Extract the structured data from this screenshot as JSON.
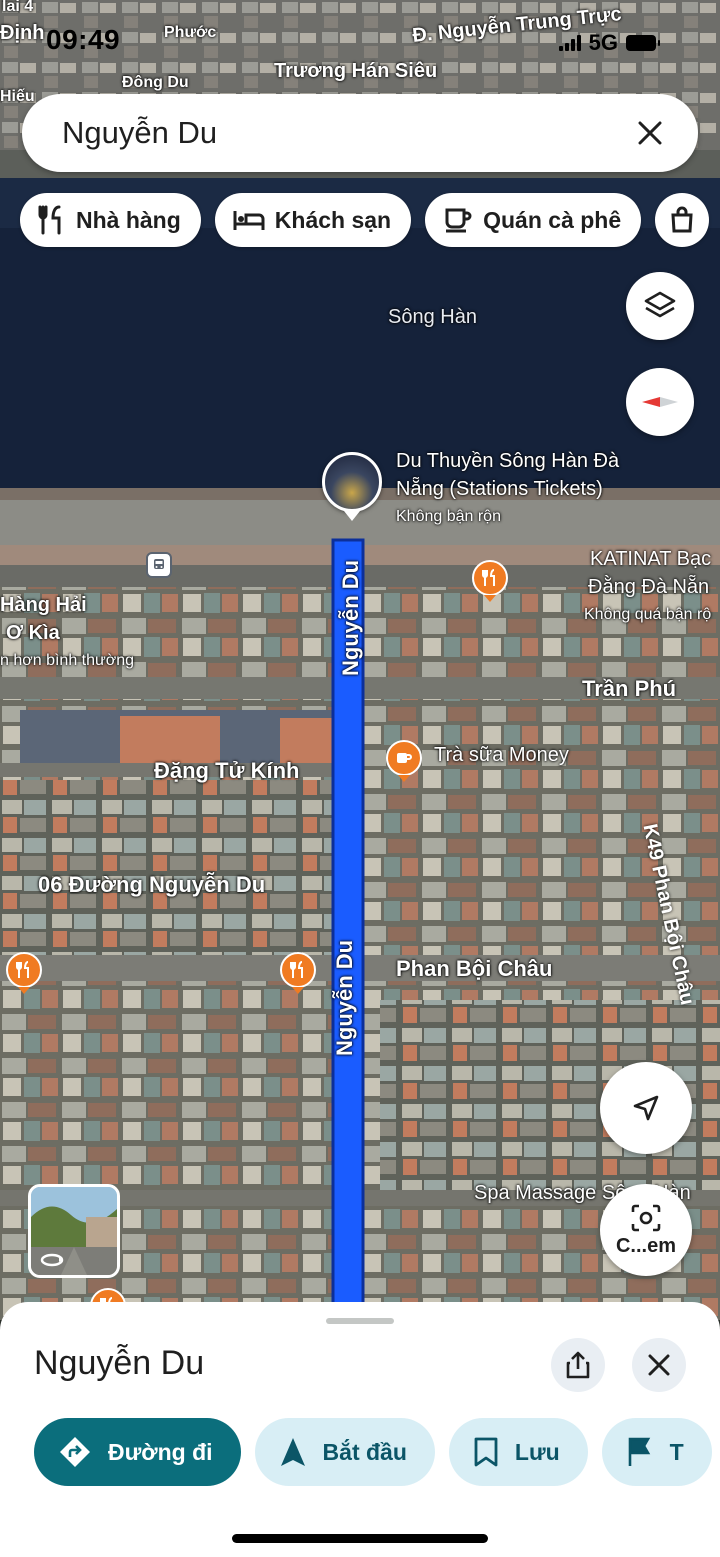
{
  "status_bar": {
    "time": "09:49",
    "network": "5G"
  },
  "search": {
    "query": "Nguyễn Du"
  },
  "chips": [
    {
      "label": "Nhà hàng",
      "icon": "restaurant-icon"
    },
    {
      "label": "Khách sạn",
      "icon": "hotel-icon"
    },
    {
      "label": "Quán cà phê",
      "icon": "cafe-icon"
    }
  ],
  "map": {
    "labels": {
      "top_left_1": "lai 4",
      "top_left_2": "Định",
      "top_phuoc": "Phước",
      "nguyen_trung_truc": "Đ. Nguyễn Trung Trực",
      "truong_han_sieu": "Trương Hán Siêu",
      "dong_du": "Đông Du",
      "hieu": "Hiếu",
      "song_han": "Sông Hàn",
      "tran_phu": "Trần Phú",
      "dang_tu_kinh": "Đặng Tử Kính",
      "nguyen_du_06": "06 Đường Nguyễn Du",
      "phan_boi_chau": "Phan Bội Châu",
      "k49": "K49 Phan Bội Châu",
      "hang_hai_1": "Hàng Hải",
      "hang_hai_2": "Ơ Kìa",
      "hang_hai_3": "n hơn bình thường",
      "spa": "Spa Massage Sông Hàn",
      "road_nguyen_du": "Nguyễn Du"
    },
    "places": {
      "du_thuyen_1": "Du Thuyền Sông Hàn Đà",
      "du_thuyen_2": "Nẵng (Stations Tickets)",
      "du_thuyen_status": "Không bận rộn",
      "katinat_1": "KATINAT Bạc",
      "katinat_2": "Đằng Đà Nẵn",
      "katinat_status": "Không quá bận rộ",
      "tra_sua": "Trà sữa Money"
    },
    "camera_button_label": "C...em"
  },
  "sheet": {
    "title": "Nguyễn Du",
    "actions": [
      {
        "label": "Đường đi",
        "icon": "directions-icon",
        "primary": true
      },
      {
        "label": "Bắt đầu",
        "icon": "navigation-arrow-icon"
      },
      {
        "label": "Lưu",
        "icon": "bookmark-icon"
      },
      {
        "label": "T",
        "icon": "flag-icon"
      }
    ]
  },
  "colors": {
    "route": "#1a5cff",
    "primary": "#0b6e7c",
    "poi": "#f07b22"
  }
}
